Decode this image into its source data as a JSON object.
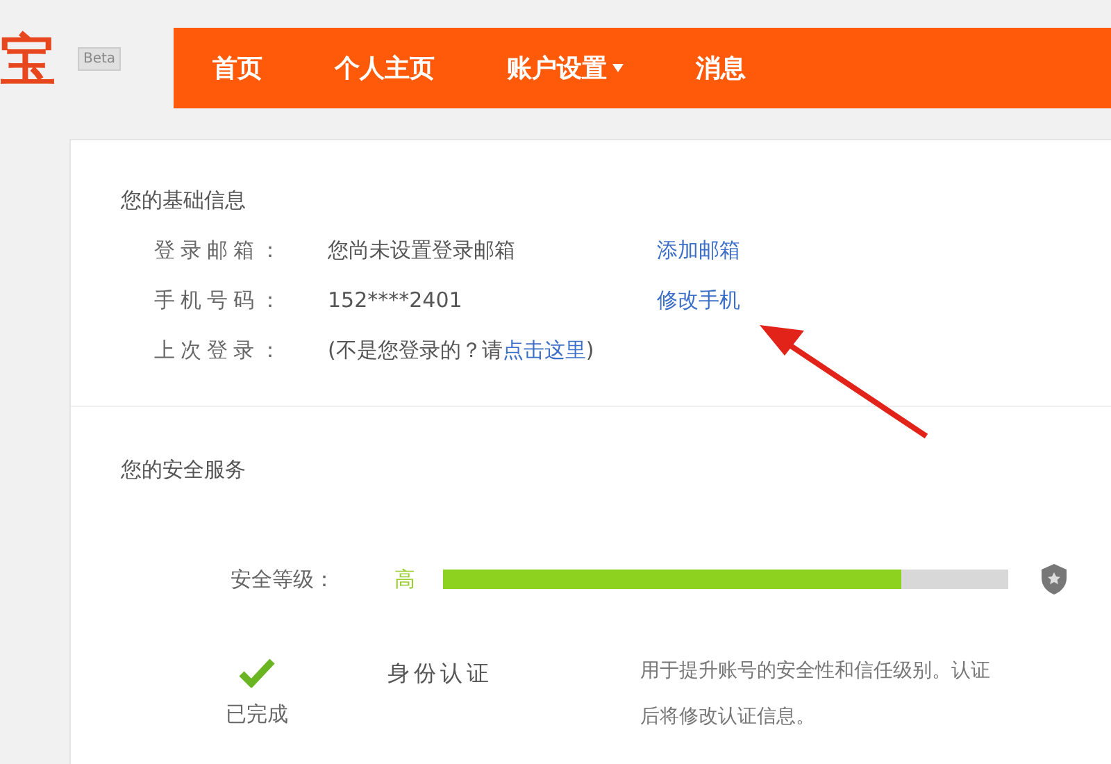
{
  "header": {
    "logo": "宝",
    "badge": "Beta",
    "nav": [
      {
        "label": "首页",
        "dropdown": false
      },
      {
        "label": "个人主页",
        "dropdown": false
      },
      {
        "label": "账户设置",
        "dropdown": true
      },
      {
        "label": "消息",
        "dropdown": false
      }
    ]
  },
  "basic_info": {
    "title": "您的基础信息",
    "rows": [
      {
        "label": "登录邮箱：",
        "value": "您尚未设置登录邮箱",
        "link": "添加邮箱"
      },
      {
        "label": "手机号码：",
        "value": "152****2401",
        "link": "修改手机"
      },
      {
        "label": "上次登录：",
        "value": "(不是您登录的？请",
        "link": "点击这里",
        "suffix": ")"
      }
    ]
  },
  "security": {
    "title": "您的安全服务",
    "level_label": "安全等级：",
    "level_text": "高",
    "level": 0.81,
    "items": [
      {
        "done": true,
        "status": "已完成",
        "name": "身份认证",
        "description": [
          "用于提升账号的安全性和信任级别。认证",
          "后将修改认证信息。"
        ]
      }
    ]
  }
}
